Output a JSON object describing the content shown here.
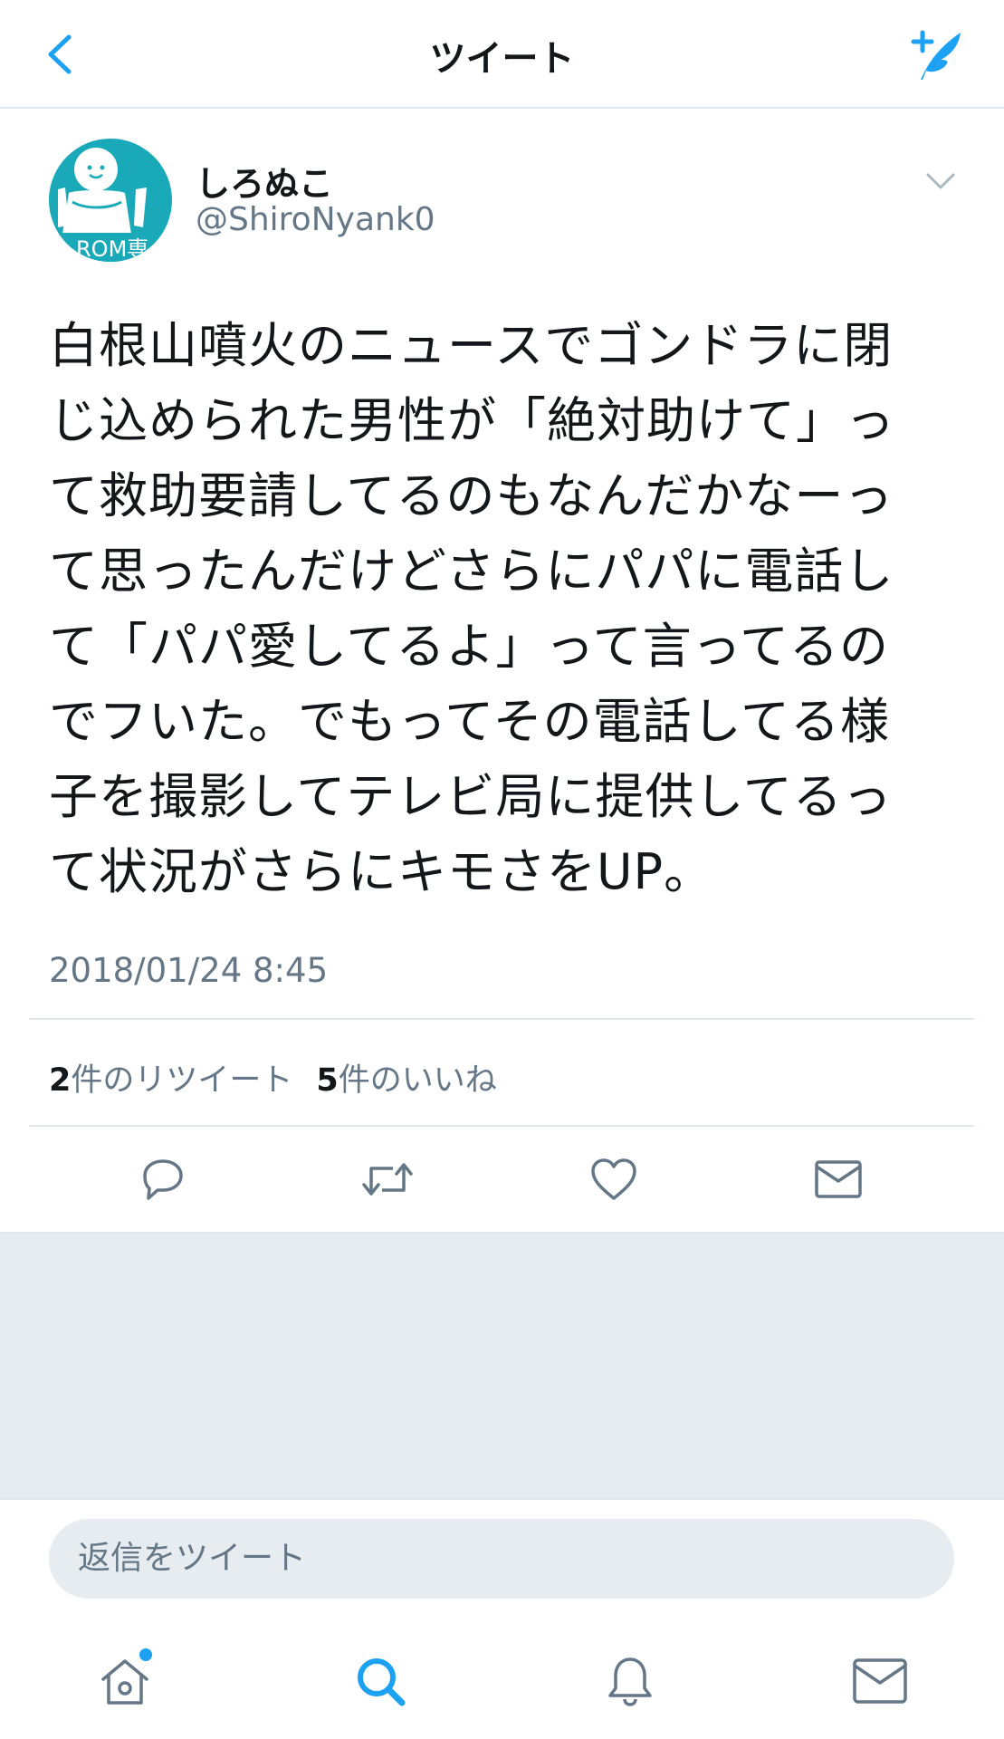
{
  "header": {
    "title": "ツイート",
    "back_icon": "chevron-left-icon",
    "compose_icon": "compose-tweet-icon"
  },
  "tweet": {
    "display_name": "しろぬこ",
    "handle": "@ShiroNyank0",
    "avatar_text": "ROM専",
    "lines": [
      "白根山噴火のニュースでゴンドラに閉",
      "じ込められた男性が「絶対助けて」っ",
      "て救助要請してるのもなんだかなーっ",
      "て思ったんだけどさらにパパに電話し",
      "て「パパ愛してるよ」って言ってるの",
      "でフいた。でもってその電話してる様",
      "子を撮影してテレビ局に提供してるっ",
      "て状況がさらにキモさをUP。"
    ],
    "timestamp": "2018/01/24 8:45",
    "retweet_count": "2",
    "retweet_label": "件のリツイート",
    "like_count": "5",
    "like_label": "件のいいね"
  },
  "reply": {
    "placeholder": "返信をツイート"
  },
  "colors": {
    "accent": "#1da1f2",
    "icon_gray": "#657786",
    "background_gray": "#e6ecf0",
    "avatar_teal": "#1aa9b8"
  }
}
